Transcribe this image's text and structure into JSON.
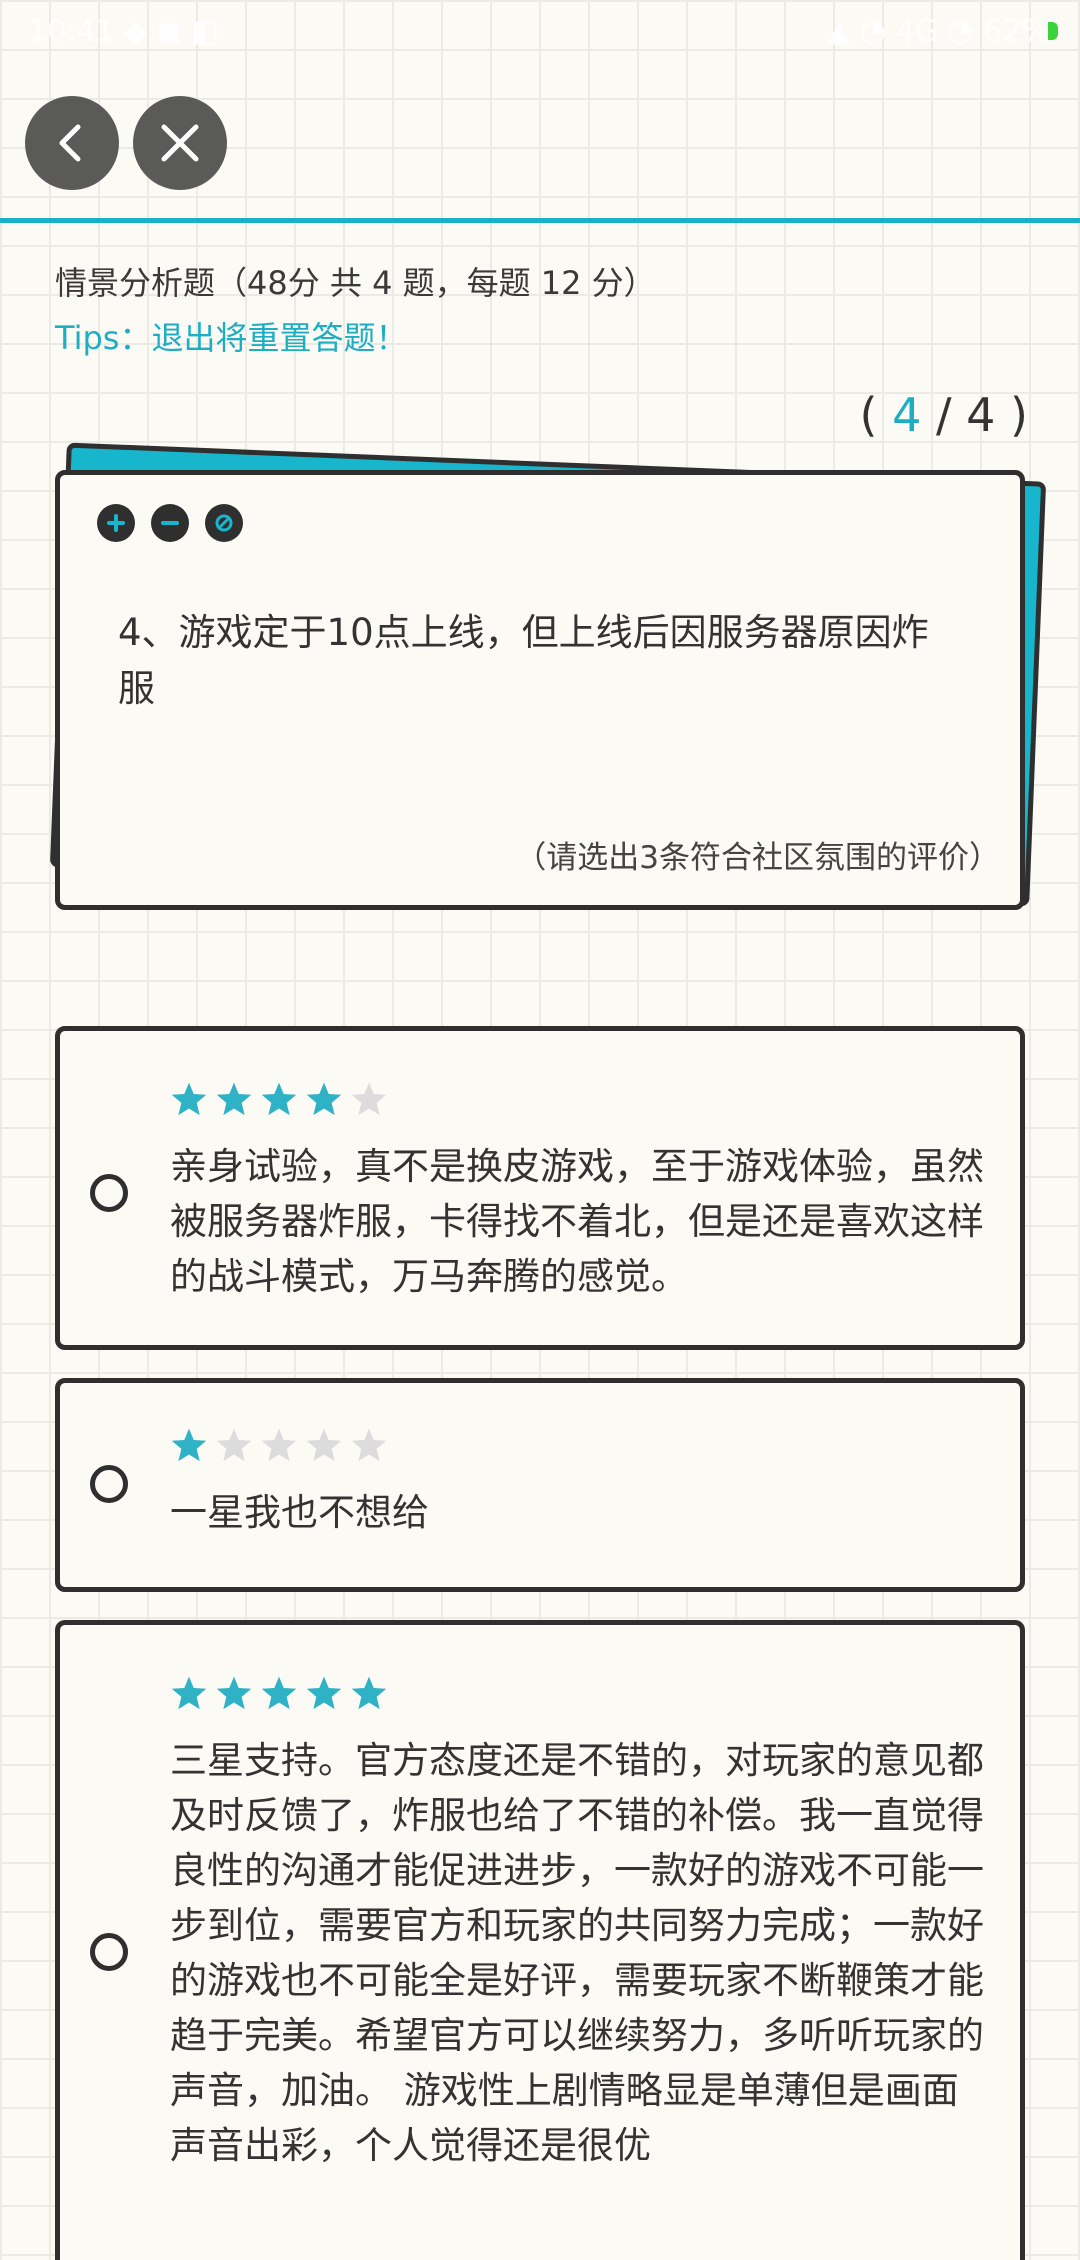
{
  "status_bar": {
    "left_text": "10:41 ◆ ◼ ◧",
    "right_text": "▲ ◔ 4G ◔ 62%"
  },
  "nav": {
    "back_icon": "chevron-left-icon",
    "close_icon": "close-icon"
  },
  "section": {
    "title": "情景分析题（48分 共 4 题，每题 12 分）",
    "tips": "Tips：退出将重置答题！"
  },
  "progress": {
    "open": "(",
    "current": "4",
    "sep": "/",
    "total": "4",
    "close": ")"
  },
  "question": {
    "text": "4、游戏定于10点上线，但上线后因服务器原因炸服",
    "hint": "（请选出3条符合社区氛围的评价）",
    "icons": [
      "zoom-in-icon",
      "zoom-out-icon",
      "cancel-icon"
    ]
  },
  "options": [
    {
      "rating": 4,
      "text": "亲身试验，真不是换皮游戏，至于游戏体验，虽然被服务器炸服，卡得找不着北，但是还是喜欢这样的战斗模式，万马奔腾的感觉。"
    },
    {
      "rating": 1,
      "text": "一星我也不想给"
    },
    {
      "rating": 5,
      "text": "三星支持。官方态度还是不错的，对玩家的意见都及时反馈了，炸服也给了不错的补偿。我一直觉得良性的沟通才能促进进步，一款好的游戏不可能一步到位，需要官方和玩家的共同努力完成；一款好的游戏也不可能全是好评，需要玩家不断鞭策才能趋于完美。希望官方可以继续努力，多听听玩家的声音，加油。 游戏性上剧情略显是单薄但是画面声音出彩，个人觉得还是很优"
    }
  ],
  "colors": {
    "accent": "#1eaec4",
    "star_filled": "#2fb1c6",
    "star_empty": "#dcdcdc",
    "card_border": "#2f2f2f",
    "card_back": "#17b6cc"
  }
}
